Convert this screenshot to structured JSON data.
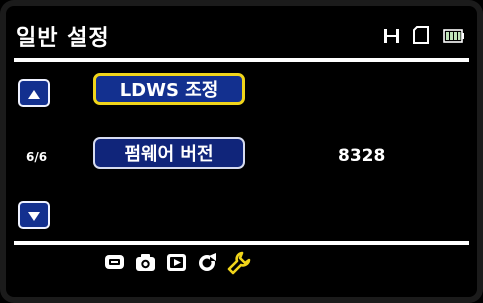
{
  "header": {
    "title": "일반 설정",
    "icons": [
      "film-icon",
      "sd-card-icon",
      "battery-icon"
    ]
  },
  "menu": {
    "items": [
      {
        "label": "LDWS 조정",
        "selected": true
      },
      {
        "label": "펌웨어 버전",
        "value": "8328"
      }
    ],
    "page_indicator": "6/6"
  },
  "navigation": {
    "up_icon": "up-arrow-icon",
    "down_icon": "down-arrow-icon"
  },
  "tabbar": {
    "tabs": [
      "video-settings-icon",
      "camera-icon",
      "playback-icon",
      "sound-icon",
      "wrench-icon"
    ],
    "active": "wrench-icon"
  },
  "colors": {
    "background": "#000000",
    "button_fill": "#13308f",
    "selection_border": "#f1d51a",
    "button_border": "#d7dcf0",
    "text": "#ffffff"
  }
}
